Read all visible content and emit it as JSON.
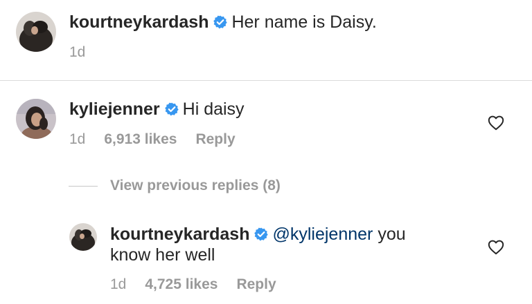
{
  "caption": {
    "username": "kourtneykardash",
    "text": "Her name is Daisy.",
    "time": "1d",
    "avatar_icon": "profile-avatar"
  },
  "comments": [
    {
      "username": "kyliejenner",
      "text": "Hi daisy",
      "time": "1d",
      "likes": "6,913 likes",
      "reply_label": "Reply",
      "avatar_icon": "profile-avatar"
    }
  ],
  "view_replies": "View previous replies (8)",
  "replies": [
    {
      "username": "kourtneykardash",
      "mention": "@kyliejenner",
      "text_line1": "you",
      "text_line2": "know her well",
      "time": "1d",
      "likes": "4,725 likes",
      "reply_label": "Reply",
      "avatar_icon": "profile-avatar"
    }
  ],
  "icons": {
    "verified": "verified-badge-icon",
    "like": "heart-outline-icon"
  },
  "colors": {
    "verified_blue": "#3897f0",
    "meta_gray": "#999999",
    "text_dark": "#262626",
    "mention_blue": "#003569"
  }
}
